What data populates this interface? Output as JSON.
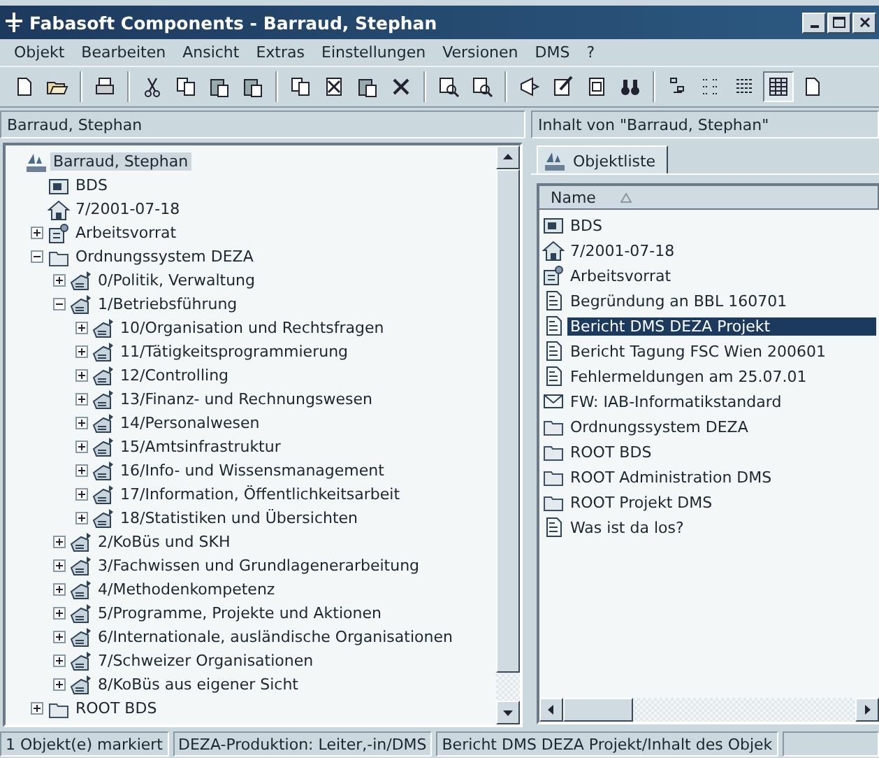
{
  "window": {
    "title": "Fabasoft Components - Barraud, Stephan"
  },
  "menu": [
    "Objekt",
    "Bearbeiten",
    "Ansicht",
    "Extras",
    "Einstellungen",
    "Versionen",
    "DMS",
    "?"
  ],
  "toolbar": [
    {
      "kind": "new",
      "pressed": false
    },
    {
      "kind": "open",
      "pressed": false
    },
    {
      "kind": "sep"
    },
    {
      "kind": "print",
      "pressed": false
    },
    {
      "kind": "sep"
    },
    {
      "kind": "cut",
      "pressed": false
    },
    {
      "kind": "copy",
      "pressed": false
    },
    {
      "kind": "paste",
      "pressed": false
    },
    {
      "kind": "paste",
      "pressed": false
    },
    {
      "kind": "sep"
    },
    {
      "kind": "copy",
      "pressed": false
    },
    {
      "kind": "remove",
      "pressed": false
    },
    {
      "kind": "paste",
      "pressed": false
    },
    {
      "kind": "delete",
      "pressed": false
    },
    {
      "kind": "sep"
    },
    {
      "kind": "find",
      "pressed": false
    },
    {
      "kind": "find",
      "pressed": false
    },
    {
      "kind": "sep"
    },
    {
      "kind": "back",
      "pressed": false
    },
    {
      "kind": "edit",
      "pressed": false
    },
    {
      "kind": "doc",
      "pressed": false
    },
    {
      "kind": "binoculars",
      "pressed": false
    },
    {
      "kind": "sep"
    },
    {
      "kind": "icons",
      "pressed": false
    },
    {
      "kind": "list",
      "pressed": false
    },
    {
      "kind": "details",
      "pressed": false
    },
    {
      "kind": "grid",
      "pressed": true
    },
    {
      "kind": "new",
      "pressed": false
    }
  ],
  "left_header": "Barraud, Stephan",
  "right_header": "Inhalt von \"Barraud, Stephan\"",
  "tree": [
    {
      "label": "Barraud, Stephan",
      "kind": "cabinet",
      "selected": true,
      "children": [
        {
          "label": "BDS",
          "kind": "box",
          "selected": false
        },
        {
          "label": "7/2001-07-18",
          "kind": "house",
          "selected": false
        },
        {
          "label": "Arbeitsvorrat",
          "kind": "inbox",
          "selected": false,
          "expanded": false
        },
        {
          "label": "Ordnungssystem DEZA",
          "kind": "folder",
          "selected": false,
          "expanded": true,
          "children": [
            {
              "label": "0/Politik, Verwaltung",
              "kind": "register",
              "selected": false,
              "expanded": false
            },
            {
              "label": "1/Betriebsführung",
              "kind": "register",
              "selected": false,
              "expanded": true,
              "children": [
                {
                  "label": "10/Organisation und Rechtsfragen",
                  "kind": "register",
                  "selected": false,
                  "expanded": false
                },
                {
                  "label": "11/Tätigkeitsprogrammierung",
                  "kind": "register",
                  "selected": false,
                  "expanded": false
                },
                {
                  "label": "12/Controlling",
                  "kind": "register",
                  "selected": false,
                  "expanded": false
                },
                {
                  "label": "13/Finanz- und Rechnungswesen",
                  "kind": "register",
                  "selected": false,
                  "expanded": false
                },
                {
                  "label": "14/Personalwesen",
                  "kind": "register",
                  "selected": false,
                  "expanded": false
                },
                {
                  "label": "15/Amtsinfrastruktur",
                  "kind": "register",
                  "selected": false,
                  "expanded": false
                },
                {
                  "label": "16/Info- und Wissensmanagement",
                  "kind": "register",
                  "selected": false,
                  "expanded": false
                },
                {
                  "label": "17/Information, Öffentlichkeitsarbeit",
                  "kind": "register",
                  "selected": false,
                  "expanded": false
                },
                {
                  "label": "18/Statistiken und Übersichten",
                  "kind": "register",
                  "selected": false,
                  "expanded": false
                }
              ]
            },
            {
              "label": "2/KoBüs und SKH",
              "kind": "register",
              "selected": false,
              "expanded": false
            },
            {
              "label": "3/Fachwissen und Grundlagenerarbeitung",
              "kind": "register",
              "selected": false,
              "expanded": false
            },
            {
              "label": "4/Methodenkompetenz",
              "kind": "register",
              "selected": false,
              "expanded": false
            },
            {
              "label": "5/Programme, Projekte und Aktionen",
              "kind": "register",
              "selected": false,
              "expanded": false
            },
            {
              "label": "6/Internationale, ausländische Organisationen",
              "kind": "register",
              "selected": false,
              "expanded": false
            },
            {
              "label": "7/Schweizer Organisationen",
              "kind": "register",
              "selected": false,
              "expanded": false
            },
            {
              "label": "8/KoBüs aus eigener Sicht",
              "kind": "register",
              "selected": false,
              "expanded": false
            }
          ]
        },
        {
          "label": "ROOT  BDS",
          "kind": "folder",
          "selected": false,
          "expanded": false
        }
      ]
    }
  ],
  "tabs": [
    {
      "label": "Objektliste",
      "selected": true
    }
  ],
  "list": {
    "column": "Name",
    "rows": [
      {
        "label": "BDS",
        "kind": "box",
        "selected": false
      },
      {
        "label": "7/2001-07-18",
        "kind": "house",
        "selected": false
      },
      {
        "label": "Arbeitsvorrat",
        "kind": "inbox",
        "selected": false
      },
      {
        "label": "Begründung an BBL 160701",
        "kind": "document",
        "selected": false
      },
      {
        "label": "Bericht DMS DEZA Projekt",
        "kind": "document",
        "selected": true
      },
      {
        "label": "Bericht Tagung FSC Wien 200601",
        "kind": "document",
        "selected": false
      },
      {
        "label": "Fehlermeldungen am 25.07.01",
        "kind": "document",
        "selected": false
      },
      {
        "label": "FW: IAB-Informatikstandard",
        "kind": "mail",
        "selected": false
      },
      {
        "label": "Ordnungssystem DEZA",
        "kind": "folder",
        "selected": false
      },
      {
        "label": "ROOT  BDS",
        "kind": "folder",
        "selected": false
      },
      {
        "label": "ROOT Administration DMS",
        "kind": "folder",
        "selected": false
      },
      {
        "label": "ROOT Projekt DMS",
        "kind": "folder",
        "selected": false
      },
      {
        "label": "Was ist da los?",
        "kind": "document",
        "selected": false
      }
    ]
  },
  "status_bar": [
    "1 Objekt(e) markiert",
    "DEZA-Produktion: Leiter,-in/DMS",
    "Bericht DMS DEZA Projekt/Inhalt des Objek"
  ]
}
